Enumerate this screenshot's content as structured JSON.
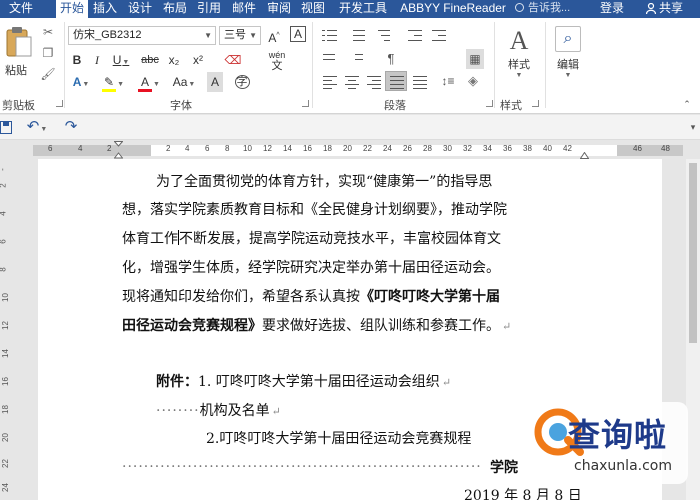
{
  "tabs": [
    {
      "label": "文件",
      "active": false
    },
    {
      "label": "开始",
      "active": true
    },
    {
      "label": "插入",
      "active": false
    },
    {
      "label": "设计",
      "active": false
    },
    {
      "label": "布局",
      "active": false
    },
    {
      "label": "引用",
      "active": false
    },
    {
      "label": "邮件",
      "active": false
    },
    {
      "label": "审阅",
      "active": false
    },
    {
      "label": "视图",
      "active": false
    },
    {
      "label": "开发工具",
      "active": false
    },
    {
      "label": "ABBYY FineReader",
      "active": false
    }
  ],
  "tell_me": "告诉我...",
  "login": "登录",
  "share": "共享",
  "ribbon": {
    "clipboard": {
      "paste": "粘贴",
      "label": "剪贴板"
    },
    "font": {
      "name": "仿宋_GB2312",
      "size": "三号",
      "label": "字体",
      "bold": "B",
      "italic": "I",
      "underline": "U",
      "strike": "abc",
      "subscript": "x₂",
      "superscript": "x²",
      "grow": "A",
      "shrink": "A",
      "case": "Aa",
      "wen": "wén",
      "char_border": "A",
      "char_shade": "A",
      "font_color": "A",
      "enclose": "字"
    },
    "paragraph": {
      "label": "段落"
    },
    "styles": {
      "button": "样式",
      "label": "样式"
    },
    "editing": {
      "button": "编辑"
    }
  },
  "colors": {
    "tab_bar": "#2b579a",
    "highlight_yellow": "#ffff00",
    "font_red": "#e81123"
  },
  "ruler": {
    "numbers": [
      "6",
      "4",
      "2",
      "2",
      "4",
      "6",
      "8",
      "10",
      "12",
      "14",
      "16",
      "18",
      "20",
      "22",
      "24",
      "26",
      "28",
      "30",
      "32",
      "34",
      "36",
      "38",
      "40",
      "42",
      "46",
      "48"
    ],
    "vertical": [
      "-",
      "2",
      "4",
      "6",
      "8",
      "10",
      "12",
      "14",
      "16",
      "18",
      "20",
      "22",
      "24"
    ]
  },
  "document": {
    "p1_l1": "为了全面贯彻党的体育方针，实现“健康第一”的指导思",
    "p1_l2": "想，落实学院素质教育目标和《全民健身计划纲要》，推动学院",
    "p1_l3a": "体育工作",
    "p1_l3b": "不断发展，提高学院运动竞技水平，丰富校园体育文",
    "p1_l4": "化，增强学生体质，经学院研究决定举办第十届田径运动会。",
    "p1_l5a": "现将通知印发给你们，希望各系认真按",
    "p1_l5b": "《叮咚叮咚大学第十届",
    "p1_l6a": "田径运动会竞赛规程》",
    "p1_l6b": "要求做好选拔、组队训练和参赛工作。",
    "att_label": "附件：",
    "att_1": "1. 叮咚叮咚大学第十届田径运动会组织",
    "att_1_cont": "机构及名单",
    "att_2": "2.叮咚叮咚大学第十届田径运动会竞赛规程",
    "sign": "学院",
    "date": "2019 年 8 月 8 日"
  },
  "watermark": {
    "name": "查询啦",
    "url": "chaxunla.com"
  }
}
